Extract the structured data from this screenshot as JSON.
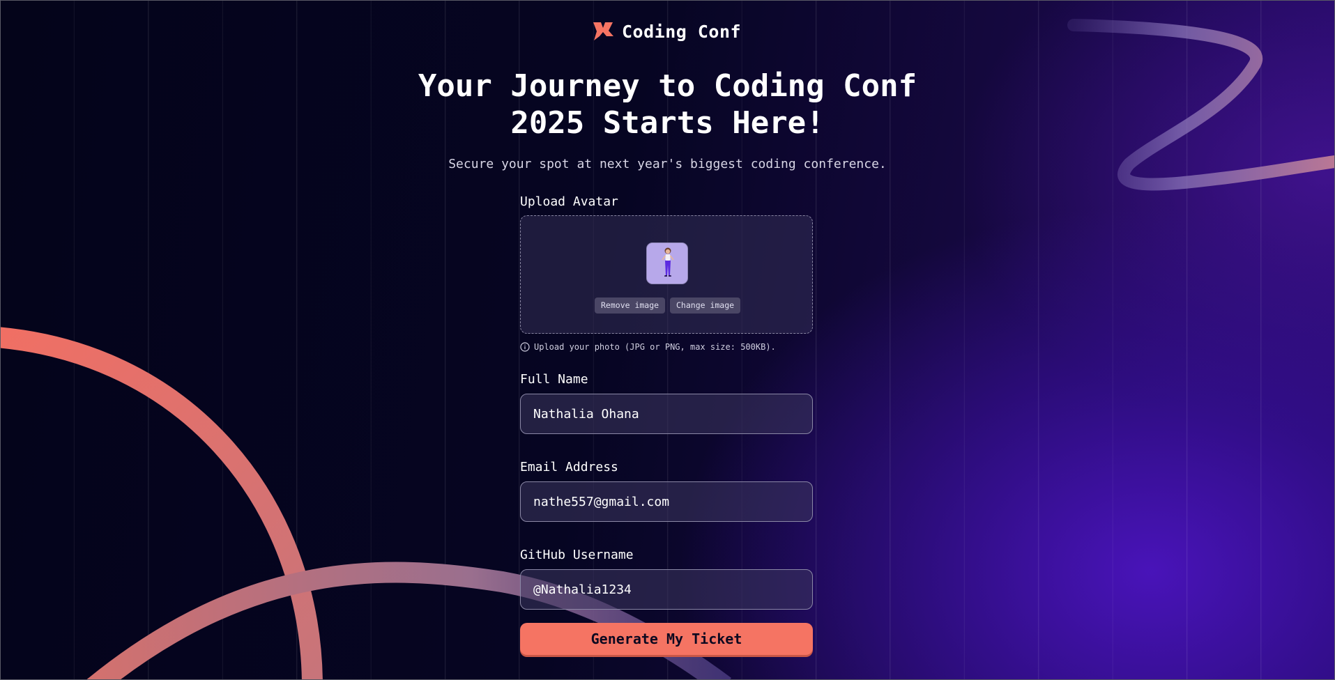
{
  "brand": {
    "name": "Coding Conf",
    "logo_icon": "coding-conf-logo-icon",
    "accent_color": "#f57463"
  },
  "hero": {
    "title_line1": "Your Journey to Coding Conf",
    "title_line2": "2025 Starts Here!",
    "subtitle": "Secure your spot at next year's biggest coding conference."
  },
  "form": {
    "avatar": {
      "label": "Upload Avatar",
      "remove_label": "Remove image",
      "change_label": "Change image",
      "hint_icon": "info-icon",
      "hint": "Upload your photo (JPG or PNG, max size: 500KB)."
    },
    "full_name": {
      "label": "Full Name",
      "value": "Nathalia Ohana"
    },
    "email": {
      "label": "Email Address",
      "value": "nathe557@gmail.com"
    },
    "github": {
      "label": "GitHub Username",
      "value": "@Nathalia1234"
    },
    "submit_label": "Generate My Ticket"
  }
}
